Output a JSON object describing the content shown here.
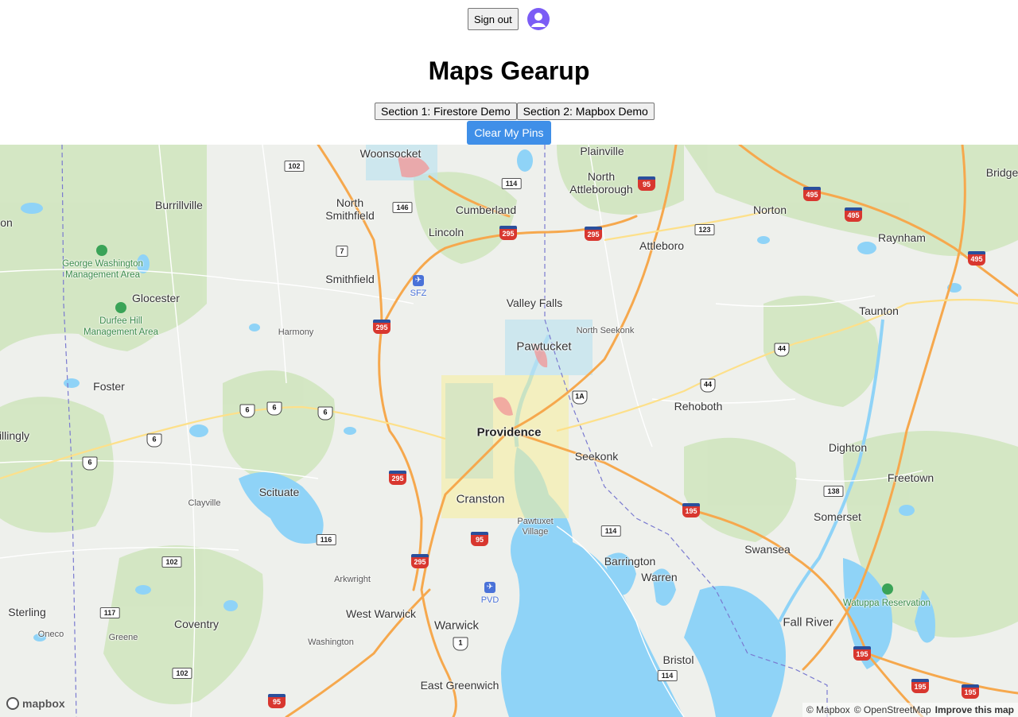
{
  "header": {
    "sign_out_label": "Sign out",
    "title": "Maps Gearup",
    "tabs": [
      {
        "label": "Section 1: Firestore Demo"
      },
      {
        "label": "Section 2: Mapbox Demo"
      }
    ],
    "clear_button_label": "Clear My Pins"
  },
  "colors": {
    "clear_button": "#3f8fe8",
    "avatar": "#7b5cf5",
    "water": "#8fd3f7",
    "park": "#cfe5bd",
    "highway": "#f6a84d"
  },
  "map": {
    "places": [
      {
        "name": "Woonsocket",
        "kind": "city"
      },
      {
        "name": "Plainville",
        "kind": "city"
      },
      {
        "name": "Bridge",
        "kind": "city"
      },
      {
        "name": "Burrillville",
        "kind": "city"
      },
      {
        "name": "North Smithfield",
        "kind": "city"
      },
      {
        "name": "Cumberland",
        "kind": "city"
      },
      {
        "name": "North Attleborough",
        "kind": "city"
      },
      {
        "name": "Norton",
        "kind": "city"
      },
      {
        "name": "on",
        "kind": "city"
      },
      {
        "name": "Lincoln",
        "kind": "city"
      },
      {
        "name": "Attleboro",
        "kind": "city"
      },
      {
        "name": "Raynham",
        "kind": "city"
      },
      {
        "name": "Smithfield",
        "kind": "city"
      },
      {
        "name": "Glocester",
        "kind": "city"
      },
      {
        "name": "Valley Falls",
        "kind": "city"
      },
      {
        "name": "Taunton",
        "kind": "city"
      },
      {
        "name": "Harmony",
        "kind": "small"
      },
      {
        "name": "North Seekonk",
        "kind": "small"
      },
      {
        "name": "Pawtucket",
        "kind": "city"
      },
      {
        "name": "Foster",
        "kind": "city"
      },
      {
        "name": "Rehoboth",
        "kind": "city"
      },
      {
        "name": "illingly",
        "kind": "city"
      },
      {
        "name": "Providence",
        "kind": "major"
      },
      {
        "name": "Seekonk",
        "kind": "city"
      },
      {
        "name": "Dighton",
        "kind": "city"
      },
      {
        "name": "Freetown",
        "kind": "city"
      },
      {
        "name": "Scituate",
        "kind": "city"
      },
      {
        "name": "Clayville",
        "kind": "small"
      },
      {
        "name": "Cranston",
        "kind": "city"
      },
      {
        "name": "Pawtuxet Village",
        "kind": "small"
      },
      {
        "name": "Somerset",
        "kind": "city"
      },
      {
        "name": "Swansea",
        "kind": "city"
      },
      {
        "name": "Barrington",
        "kind": "city"
      },
      {
        "name": "Warren",
        "kind": "city"
      },
      {
        "name": "Arkwright",
        "kind": "small"
      },
      {
        "name": "Sterling",
        "kind": "city"
      },
      {
        "name": "Coventry",
        "kind": "city"
      },
      {
        "name": "West Warwick",
        "kind": "city"
      },
      {
        "name": "Warwick",
        "kind": "city"
      },
      {
        "name": "Fall River",
        "kind": "city"
      },
      {
        "name": "Oneco",
        "kind": "small"
      },
      {
        "name": "Greene",
        "kind": "small"
      },
      {
        "name": "Washington",
        "kind": "small"
      },
      {
        "name": "Bristol",
        "kind": "city"
      },
      {
        "name": "East Greenwich",
        "kind": "city"
      }
    ],
    "parks": [
      {
        "name": "George Washington Management Area"
      },
      {
        "name": "Durfee Hill Management Area"
      },
      {
        "name": "Watuppa Reservation"
      }
    ],
    "airports": [
      {
        "code": "SFZ"
      },
      {
        "code": "PVD"
      }
    ],
    "shields": [
      {
        "type": "state",
        "number": "102"
      },
      {
        "type": "state",
        "number": "114"
      },
      {
        "type": "state",
        "number": "146"
      },
      {
        "type": "interstate",
        "number": "95"
      },
      {
        "type": "interstate",
        "number": "495"
      },
      {
        "type": "interstate",
        "number": "495"
      },
      {
        "type": "interstate",
        "number": "295"
      },
      {
        "type": "interstate",
        "number": "295"
      },
      {
        "type": "state",
        "number": "123"
      },
      {
        "type": "interstate",
        "number": "495"
      },
      {
        "type": "state",
        "number": "7"
      },
      {
        "type": "interstate",
        "number": "295"
      },
      {
        "type": "us",
        "number": "44"
      },
      {
        "type": "us",
        "number": "44"
      },
      {
        "type": "us",
        "number": "1A"
      },
      {
        "type": "us",
        "number": "6"
      },
      {
        "type": "us",
        "number": "6"
      },
      {
        "type": "us",
        "number": "6"
      },
      {
        "type": "us",
        "number": "6"
      },
      {
        "type": "us",
        "number": "6"
      },
      {
        "type": "interstate",
        "number": "295"
      },
      {
        "type": "state",
        "number": "138"
      },
      {
        "type": "interstate",
        "number": "195"
      },
      {
        "type": "state",
        "number": "116"
      },
      {
        "type": "interstate",
        "number": "95"
      },
      {
        "type": "state",
        "number": "114"
      },
      {
        "type": "state",
        "number": "102"
      },
      {
        "type": "interstate",
        "number": "295"
      },
      {
        "type": "state",
        "number": "117"
      },
      {
        "type": "us",
        "number": "1"
      },
      {
        "type": "interstate",
        "number": "195"
      },
      {
        "type": "state",
        "number": "102"
      },
      {
        "type": "state",
        "number": "114"
      },
      {
        "type": "interstate",
        "number": "195"
      },
      {
        "type": "interstate",
        "number": "195"
      },
      {
        "type": "interstate",
        "number": "95"
      }
    ],
    "logo_text": "mapbox",
    "attribution": {
      "mapbox": "© Mapbox",
      "osm": "© OpenStreetMap",
      "improve": "Improve this map"
    }
  }
}
